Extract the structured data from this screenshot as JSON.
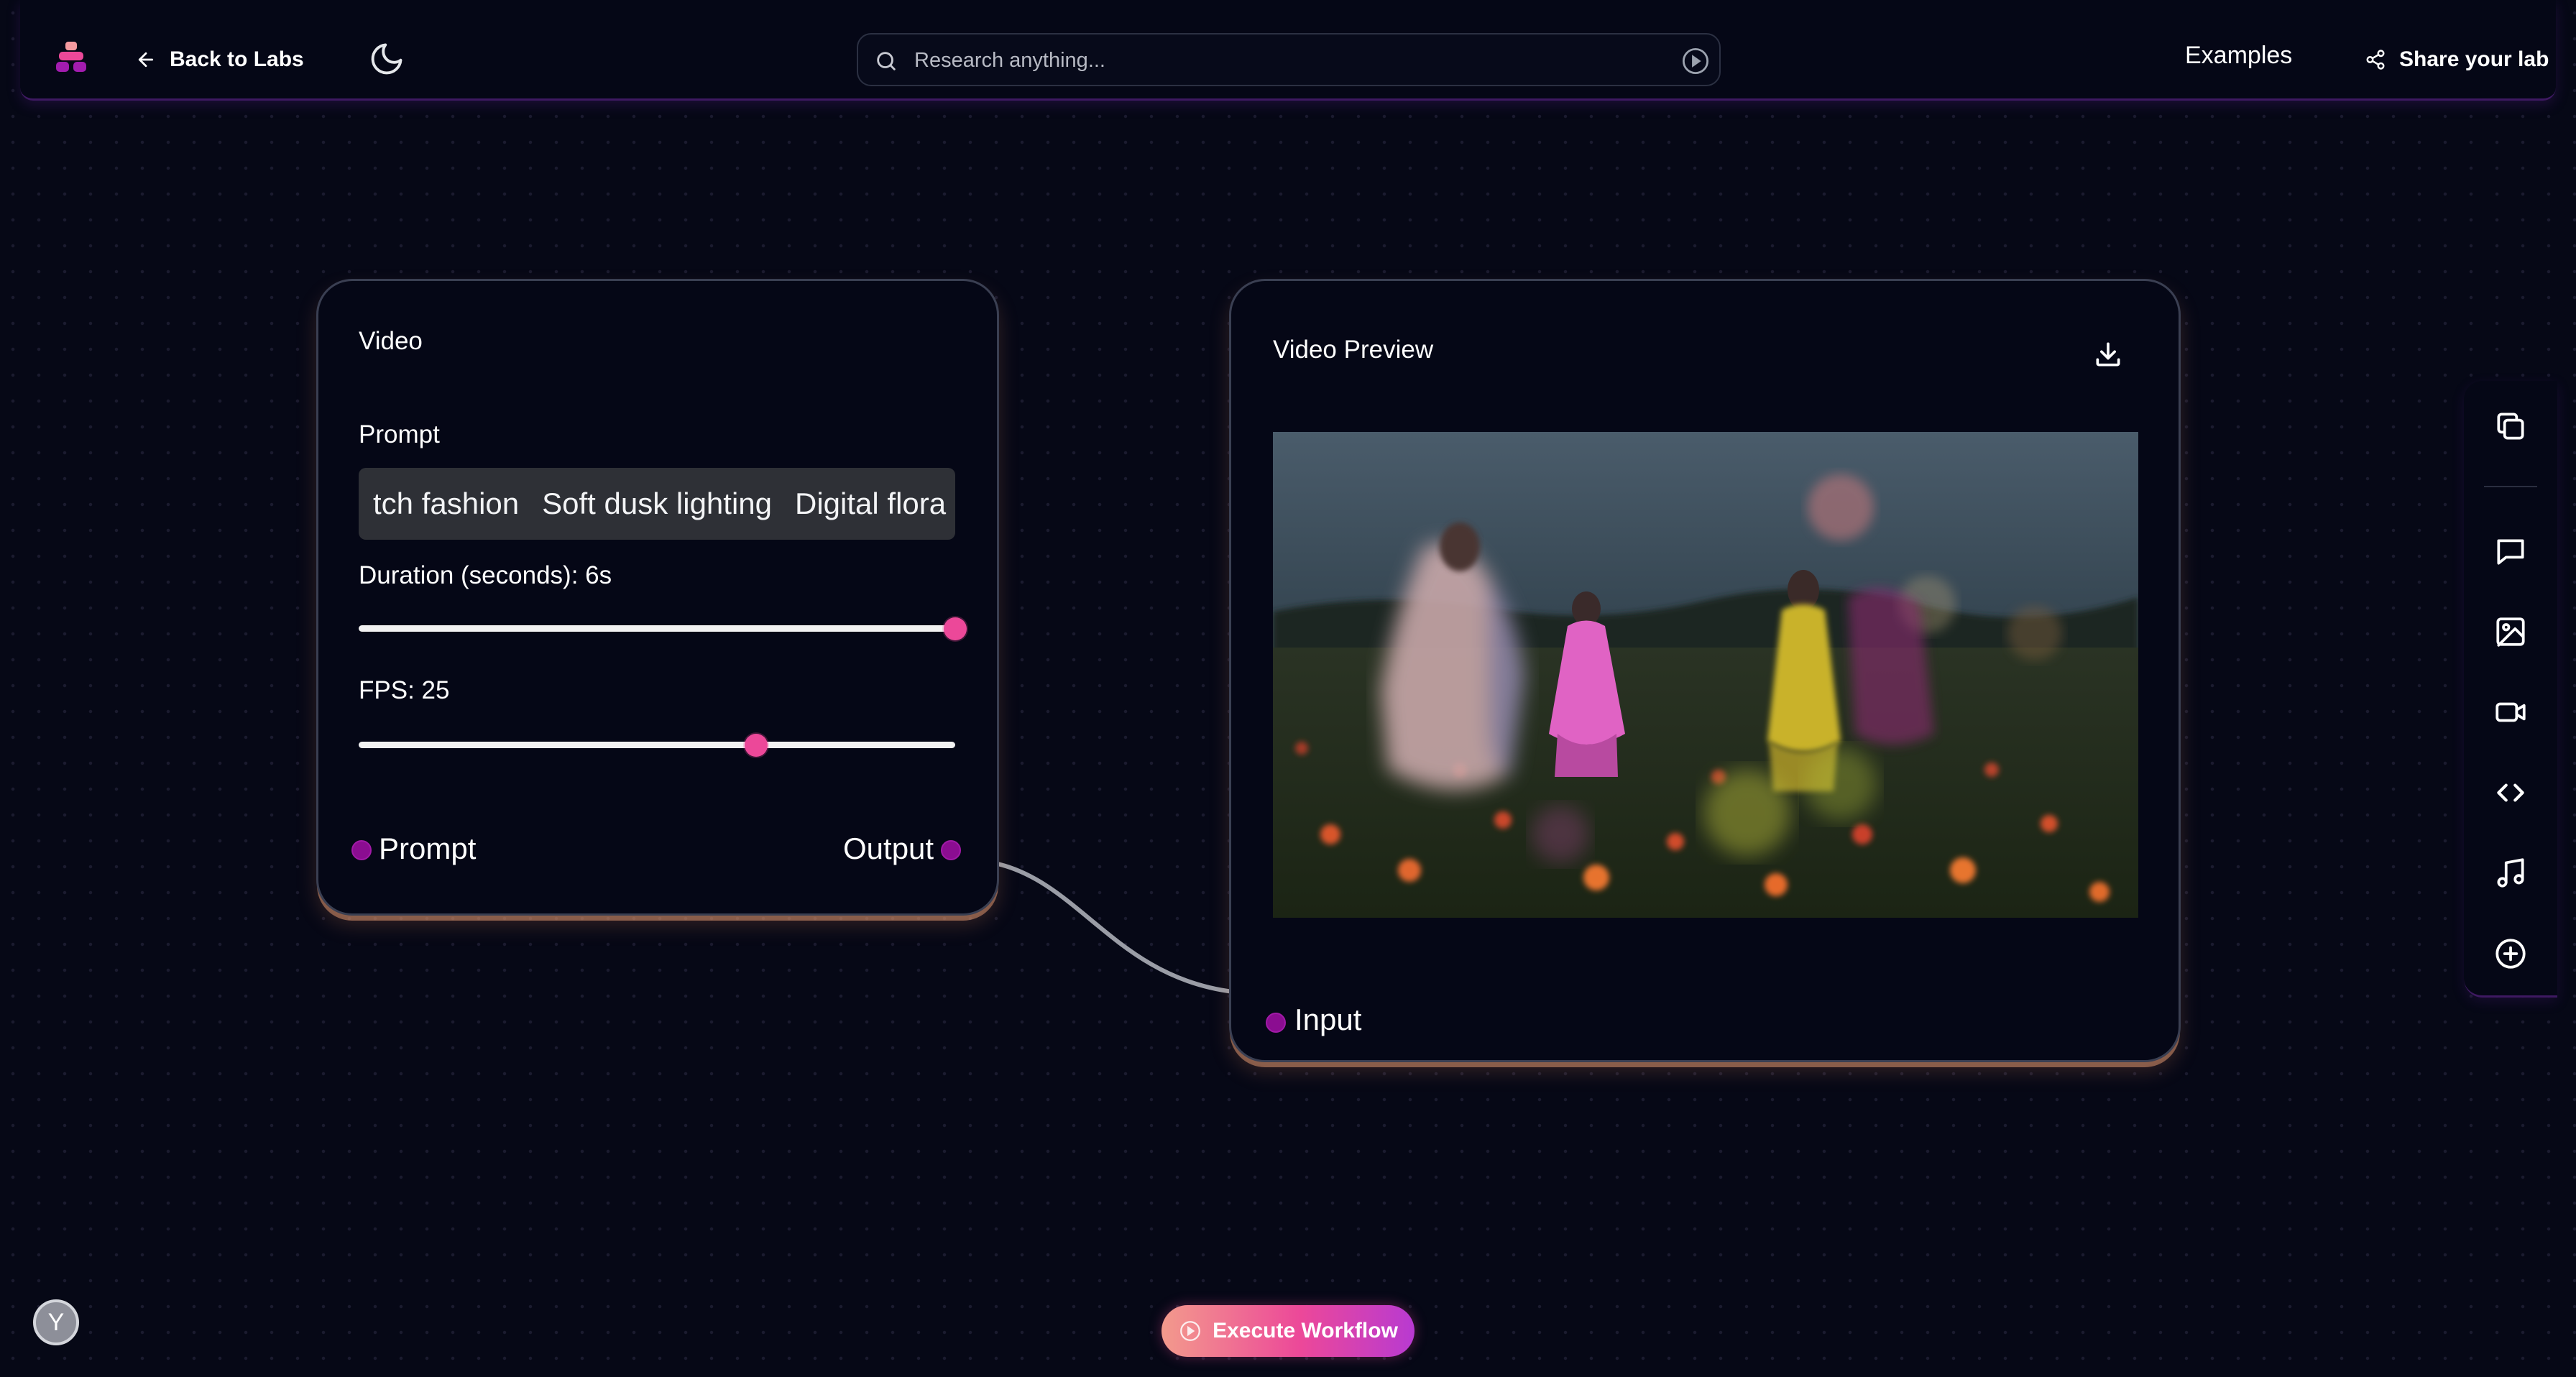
{
  "header": {
    "back_label": "Back to Labs",
    "search_placeholder": "Research anything...",
    "examples_label": "Examples",
    "share_label": "Share your lab"
  },
  "video_node": {
    "title": "Video",
    "prompt_label": "Prompt",
    "prompt_chips": [
      "tch fashion",
      "Soft dusk lighting",
      "Digital flora"
    ],
    "duration_label": "Duration (seconds): 6s",
    "duration_value": 6,
    "duration_max": 6,
    "fps_label": "FPS: 25",
    "fps_value": 25,
    "input_port_label": "Prompt",
    "output_port_label": "Output"
  },
  "preview_node": {
    "title": "Video Preview",
    "input_port_label": "Input"
  },
  "right_toolbar": {
    "items": [
      "copy-icon",
      "chat-icon",
      "image-icon",
      "video-icon",
      "code-icon",
      "music-icon",
      "add-icon"
    ]
  },
  "execute_label": "Execute Workflow",
  "avatar_initial": "Y",
  "colors": {
    "accent": "#ec4899",
    "port": "#8b0d91",
    "background": "#060816"
  }
}
